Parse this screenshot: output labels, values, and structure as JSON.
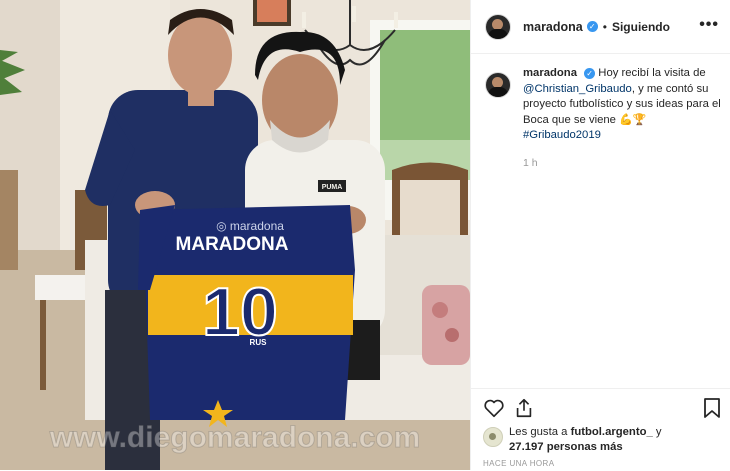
{
  "post": {
    "username": "maradona",
    "follow_sep": "•",
    "follow_status": "Siguiendo",
    "more_icon": "more-options-icon",
    "more_label": "•••"
  },
  "caption": {
    "username": "maradona",
    "text_1": "Hoy recibí la visita de",
    "mention": "@Christian_Gribaudo",
    "text_2": ", y me contó su proyecto futbolístico y sus ideas para el Boca que se viene",
    "emojis": "💪🏆",
    "hashtag": "#Gribaudo2019",
    "time": "1 h"
  },
  "likes": {
    "prefix": "Les gusta a",
    "user": "futbol.argento_",
    "middle": "y",
    "count": "27.197 personas más",
    "ago": "HACE UNA HORA"
  },
  "photo": {
    "shirt_handle": "maradona",
    "shirt_name": "MARADONA",
    "shirt_number": "10",
    "shirt_brand": "RUS",
    "tshirt_logo": "PUMA",
    "watermark": "www.diegomaradona.com"
  },
  "colors": {
    "boca_blue": "#1b2a6e",
    "boca_gold": "#f2b51c",
    "verified": "#3897f0",
    "link": "#003569"
  }
}
